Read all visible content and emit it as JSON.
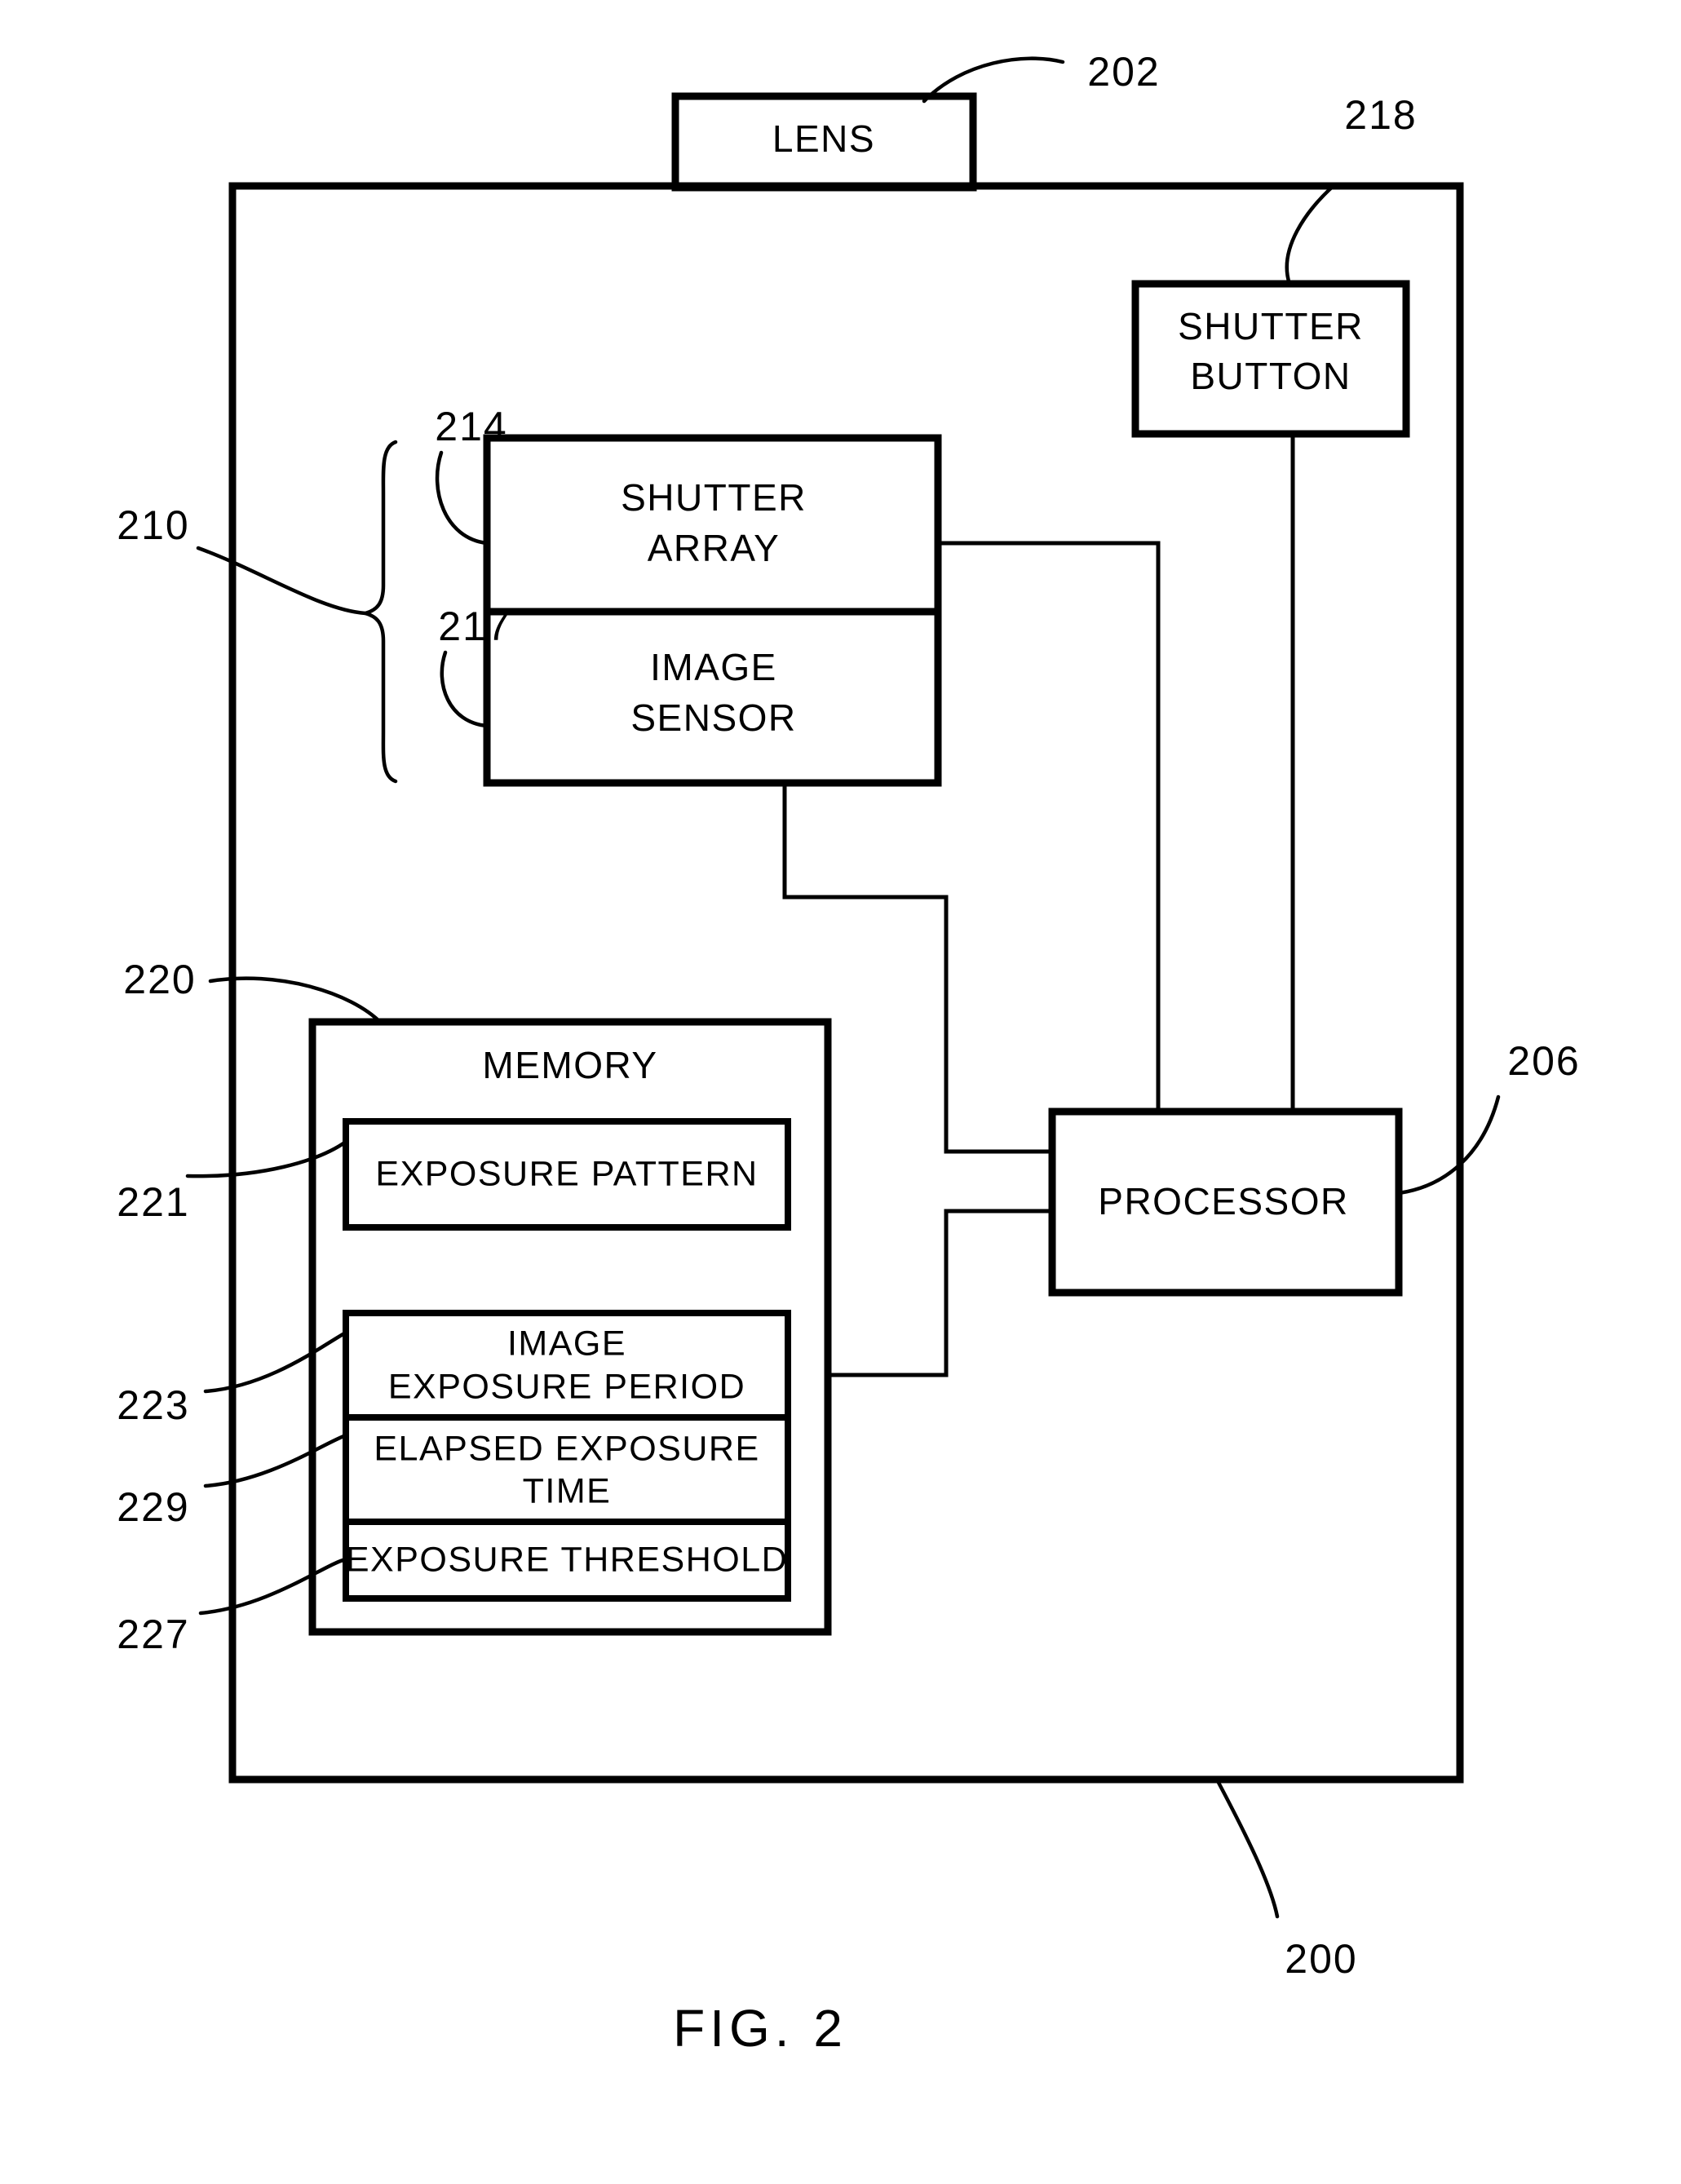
{
  "figure": {
    "caption": "FIG.  2",
    "title_block_labels": {
      "lens": "LENS",
      "shutter_button_line1": "SHUTTER",
      "shutter_button_line2": "BUTTON",
      "shutter_array_line1": "SHUTTER",
      "shutter_array_line2": "ARRAY",
      "image_sensor_line1": "IMAGE",
      "image_sensor_line2": "SENSOR",
      "memory": "MEMORY",
      "exposure_pattern": "EXPOSURE PATTERN",
      "image_exposure_period_line1": "IMAGE",
      "image_exposure_period_line2": "EXPOSURE PERIOD",
      "elapsed_exposure_time_line1": "ELAPSED EXPOSURE",
      "elapsed_exposure_time_line2": "TIME",
      "exposure_threshold": "EXPOSURE THRESHOLD",
      "processor": "PROCESSOR"
    },
    "reference_numerals": {
      "lens": "202",
      "shutter_button": "218",
      "sensor_assembly": "210",
      "shutter_array": "214",
      "image_sensor": "217",
      "memory": "220",
      "exposure_pattern": "221",
      "image_exposure_period": "223",
      "elapsed_exposure_time": "229",
      "exposure_threshold": "227",
      "processor": "206",
      "camera_device": "200"
    },
    "colors": {
      "ink": "#000000",
      "paper": "#ffffff"
    }
  }
}
